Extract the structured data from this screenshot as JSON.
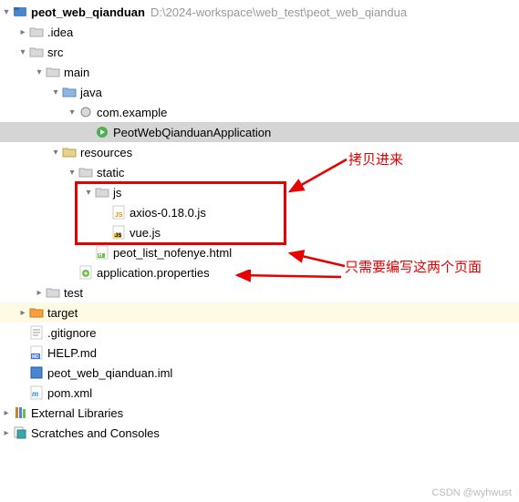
{
  "root": {
    "name": "peot_web_qianduan",
    "path": "D:\\2024-workspace\\web_test\\peot_web_qiandua"
  },
  "nodes": {
    "idea": ".idea",
    "src": "src",
    "main": "main",
    "java": "java",
    "comexample": "com.example",
    "appclass": "PeotWebQianduanApplication",
    "resources": "resources",
    "static": "static",
    "js": "js",
    "axios": "axios-0.18.0.js",
    "vue": "vue.js",
    "peothtml": "peot_list_nofenye.html",
    "appprops": "application.properties",
    "test": "test",
    "target": "target",
    "gitignore": ".gitignore",
    "helpmd": "HELP.md",
    "iml": "peot_web_qianduan.iml",
    "pom": "pom.xml",
    "extlibs": "External Libraries",
    "scratches": "Scratches and Consoles"
  },
  "annotations": {
    "copy_in": "拷贝进来",
    "edit_pages": "只需要编写这两个页面"
  },
  "watermark": "CSDN @wyhwust"
}
